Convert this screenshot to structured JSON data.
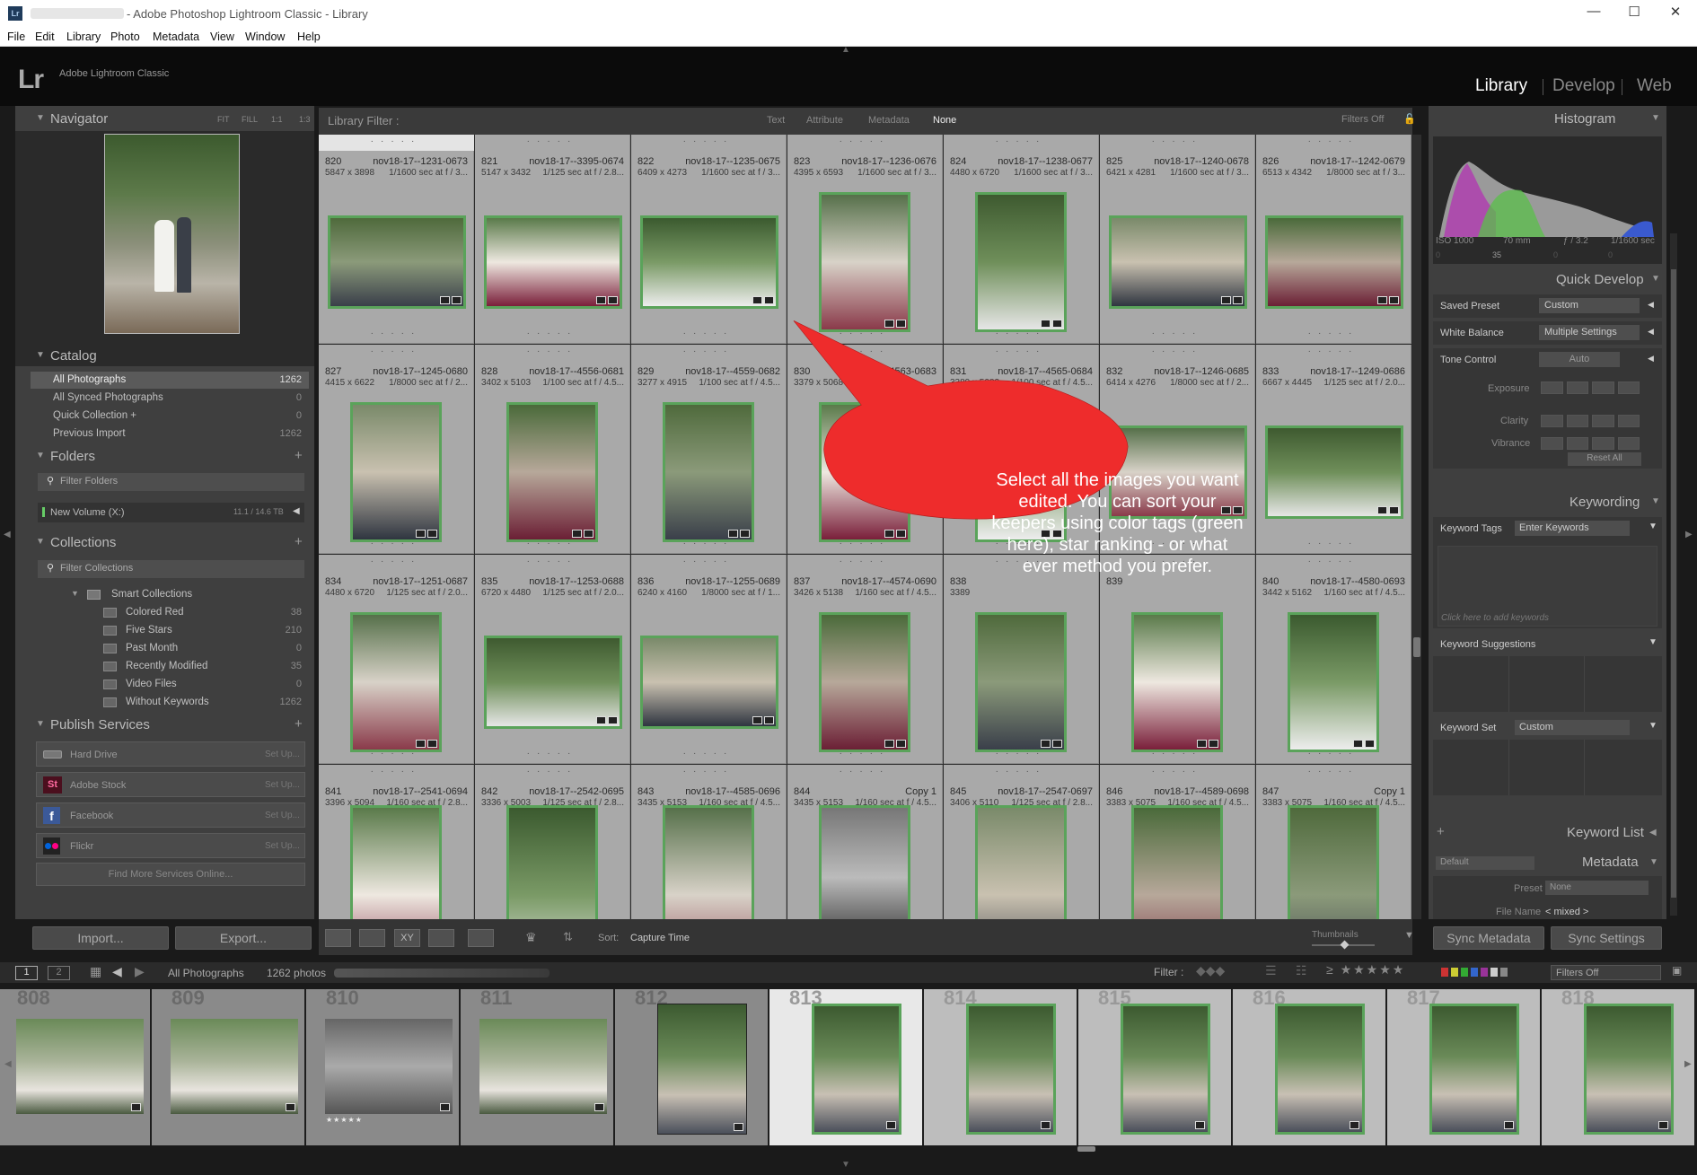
{
  "window": {
    "title": "- Adobe Photoshop Lightroom Classic - Library",
    "app_icon": "Lr",
    "controls": [
      "—",
      "☐",
      "✕"
    ]
  },
  "menu": [
    "File",
    "Edit",
    "Library",
    "Photo",
    "Metadata",
    "View",
    "Window",
    "Help"
  ],
  "identity": {
    "logo": "Lr",
    "name": "Adobe Lightroom Classic",
    "modules": [
      "Library",
      "Develop",
      "Web"
    ],
    "active_module": "Library"
  },
  "navigator": {
    "title": "Navigator",
    "zoom": [
      "FIT",
      "FILL",
      "1:1",
      "1:3"
    ]
  },
  "catalog": {
    "title": "Catalog",
    "items": [
      {
        "label": "All Photographs",
        "count": "1262"
      },
      {
        "label": "All Synced Photographs",
        "count": "0"
      },
      {
        "label": "Quick Collection +",
        "count": "0"
      },
      {
        "label": "Previous Import",
        "count": "1262"
      }
    ]
  },
  "folders": {
    "title": "Folders",
    "filter": "Filter Folders",
    "volume": "New Volume (X:)",
    "volume_size": "11.1 / 14.6 TB"
  },
  "collections": {
    "title": "Collections",
    "filter": "Filter Collections",
    "group": "Smart Collections",
    "items": [
      {
        "label": "Colored Red",
        "count": "38"
      },
      {
        "label": "Five Stars",
        "count": "210"
      },
      {
        "label": "Past Month",
        "count": "0"
      },
      {
        "label": "Recently Modified",
        "count": "35"
      },
      {
        "label": "Video Files",
        "count": "0"
      },
      {
        "label": "Without Keywords",
        "count": "1262"
      }
    ]
  },
  "publish": {
    "title": "Publish Services",
    "services": [
      {
        "label": "Hard Drive",
        "action": "Set Up..."
      },
      {
        "label": "Adobe Stock",
        "action": "Set Up..."
      },
      {
        "label": "Facebook",
        "action": "Set Up..."
      },
      {
        "label": "Flickr",
        "action": "Set Up..."
      }
    ],
    "find_more": "Find More Services Online..."
  },
  "buttons": {
    "import": "Import...",
    "export": "Export...",
    "sync_metadata": "Sync Metadata",
    "sync_settings": "Sync Settings"
  },
  "library_filter": {
    "label": "Library Filter :",
    "tabs": [
      "Text",
      "Attribute",
      "Metadata",
      "None"
    ],
    "active": "None",
    "filters_off": "Filters Off"
  },
  "grid": {
    "cells": [
      {
        "num": "820",
        "file": "nov18-17--1231-0673",
        "dim": "5847 x 3898",
        "exif": "1/1600 sec at f / 3..."
      },
      {
        "num": "821",
        "file": "nov18-17--3395-0674",
        "dim": "5147 x 3432",
        "exif": "1/125 sec at f / 2.8..."
      },
      {
        "num": "822",
        "file": "nov18-17--1235-0675",
        "dim": "6409 x 4273",
        "exif": "1/1600 sec at f / 3..."
      },
      {
        "num": "823",
        "file": "nov18-17--1236-0676",
        "dim": "4395 x 6593",
        "exif": "1/1600 sec at f / 3..."
      },
      {
        "num": "824",
        "file": "nov18-17--1238-0677",
        "dim": "4480 x 6720",
        "exif": "1/1600 sec at f / 3..."
      },
      {
        "num": "825",
        "file": "nov18-17--1240-0678",
        "dim": "6421 x 4281",
        "exif": "1/1600 sec at f / 3..."
      },
      {
        "num": "826",
        "file": "nov18-17--1242-0679",
        "dim": "6513 x 4342",
        "exif": "1/8000 sec at f / 3..."
      },
      {
        "num": "827",
        "file": "nov18-17--1245-0680",
        "dim": "4415 x 6622",
        "exif": "1/8000 sec at f / 2..."
      },
      {
        "num": "828",
        "file": "nov18-17--4556-0681",
        "dim": "3402 x 5103",
        "exif": "1/100 sec at f / 4.5..."
      },
      {
        "num": "829",
        "file": "nov18-17--4559-0682",
        "dim": "3277 x 4915",
        "exif": "1/100 sec at f / 4.5..."
      },
      {
        "num": "830",
        "file": "17--4563-0683",
        "dim": "3379 x 5068",
        "exif": ""
      },
      {
        "num": "831",
        "file": "nov18-17--4565-0684",
        "dim": "3389 x 5083",
        "exif": "1/100 sec at f / 4.5..."
      },
      {
        "num": "832",
        "file": "nov18-17--1246-0685",
        "dim": "6414 x 4276",
        "exif": "1/8000 sec at f / 2..."
      },
      {
        "num": "833",
        "file": "nov18-17--1249-0686",
        "dim": "6667 x 4445",
        "exif": "1/125 sec at f / 2.0..."
      },
      {
        "num": "834",
        "file": "nov18-17--1251-0687",
        "dim": "4480 x 6720",
        "exif": "1/125 sec at f / 2.0..."
      },
      {
        "num": "835",
        "file": "nov18-17--1253-0688",
        "dim": "6720 x 4480",
        "exif": "1/125 sec at f / 2.0..."
      },
      {
        "num": "836",
        "file": "nov18-17--1255-0689",
        "dim": "6240 x 4160",
        "exif": "1/8000 sec at f / 1..."
      },
      {
        "num": "837",
        "file": "nov18-17--4574-0690",
        "dim": "3426 x 5138",
        "exif": "1/160 sec at f / 4.5..."
      },
      {
        "num": "838",
        "file": "",
        "dim": "3389",
        "exif": ""
      },
      {
        "num": "839",
        "file": "",
        "dim": "",
        "exif": ""
      },
      {
        "num": "840",
        "file": "nov18-17--4580-0693",
        "dim": "3442 x 5162",
        "exif": "1/160 sec at f / 4.5..."
      },
      {
        "num": "841",
        "file": "nov18-17--2541-0694",
        "dim": "3396 x 5094",
        "exif": "1/160 sec at f / 2.8..."
      },
      {
        "num": "842",
        "file": "nov18-17--2542-0695",
        "dim": "3336 x 5003",
        "exif": "1/125 sec at f / 2.8..."
      },
      {
        "num": "843",
        "file": "nov18-17--4585-0696",
        "dim": "3435 x 5153",
        "exif": "1/160 sec at f / 4.5..."
      },
      {
        "num": "844",
        "file": "Copy 1",
        "dim": "3435 x 5153",
        "exif": "1/160 sec at f / 4.5..."
      },
      {
        "num": "845",
        "file": "nov18-17--2547-0697",
        "dim": "3406 x 5110",
        "exif": "1/125 sec at f / 2.8..."
      },
      {
        "num": "846",
        "file": "nov18-17--4589-0698",
        "dim": "3383 x 5075",
        "exif": "1/160 sec at f / 4.5..."
      },
      {
        "num": "847",
        "file": "Copy 1",
        "dim": "3383 x 5075",
        "exif": "1/160 sec at f / 4.5..."
      }
    ]
  },
  "toolbar": {
    "sort_label": "Sort:",
    "sort_value": "Capture Time",
    "thumbnails": "Thumbnails"
  },
  "histogram": {
    "title": "Histogram",
    "iso": "ISO 1000",
    "focal": "70 mm",
    "aperture": "ƒ / 3.2",
    "shutter": "1/1600 sec",
    "mid_count": "35",
    "zero_a": "0",
    "zero_b": "0",
    "zero_c": "0"
  },
  "quick_develop": {
    "title": "Quick Develop",
    "saved_preset_label": "Saved Preset",
    "saved_preset_value": "Custom",
    "wb_label": "White Balance",
    "wb_value": "Multiple Settings",
    "tone_label": "Tone Control",
    "tone_auto": "Auto",
    "exposure": "Exposure",
    "clarity": "Clarity",
    "vibrance": "Vibrance",
    "reset": "Reset All"
  },
  "keywording": {
    "title": "Keywording",
    "tags_label": "Keyword Tags",
    "tags_value": "Enter Keywords",
    "placeholder": "Click here to add keywords",
    "suggestions": "Keyword Suggestions",
    "set_label": "Keyword Set",
    "set_value": "Custom"
  },
  "keyword_list": {
    "title": "Keyword List"
  },
  "metadata": {
    "title": "Metadata",
    "default": "Default",
    "preset_label": "Preset",
    "preset_value": "None",
    "filename_label": "File Name",
    "filename_value": "< mixed >"
  },
  "filmbar": {
    "pages": [
      "1",
      "2"
    ],
    "source": "All Photographs",
    "count": "1262 photos",
    "filter_label": "Filter :",
    "filters_off": "Filters Off"
  },
  "filmstrip": {
    "numbers": [
      "808",
      "809",
      "810",
      "811",
      "812",
      "813",
      "814",
      "815",
      "816",
      "817",
      "818"
    ],
    "stars": "★★★★★"
  },
  "callout": {
    "text": "Select all the images you want edited. You can sort your keepers using color tags (green here), star ranking - or what ever method you prefer.",
    "color": "#ee2c2c"
  },
  "colors": {
    "accent_green": "#5aa35a",
    "panel": "#3f3f3f",
    "background": "#1a1a1a"
  }
}
